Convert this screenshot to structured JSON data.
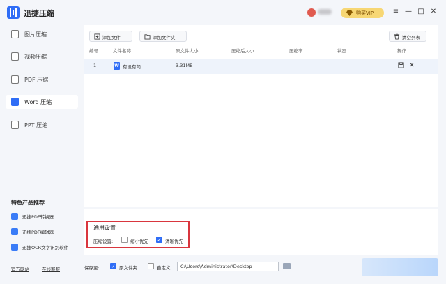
{
  "app": {
    "title": "迅捷压缩"
  },
  "header": {
    "vip_label": "购买VIP",
    "window_controls": [
      "≡",
      "—",
      "□",
      "✕"
    ],
    "accent": "#2f6df6",
    "vip_color": "#f7d774"
  },
  "sidebar": {
    "items": [
      {
        "label": "图片压缩",
        "icon": "image-icon",
        "active": false
      },
      {
        "label": "视频压缩",
        "icon": "video-icon",
        "active": false
      },
      {
        "label": "PDF 压缩",
        "icon": "pdf-icon",
        "active": false
      },
      {
        "label": "Word 压缩",
        "icon": "word-icon",
        "active": true
      },
      {
        "label": "PPT 压缩",
        "icon": "ppt-icon",
        "active": false
      }
    ],
    "featured_title": "特色产品推荐",
    "featured": [
      {
        "label": "迅捷PDF转换器",
        "icon": "pdf-converter-icon"
      },
      {
        "label": "迅捷PDF编辑器",
        "icon": "pdf-editor-icon"
      },
      {
        "label": "迅捷OCR文字识别软件",
        "icon": "ocr-icon"
      }
    ],
    "footer_links": [
      "官方网站",
      "在线客服"
    ]
  },
  "toolbar": {
    "add_file": "添加文件",
    "add_folder": "添加文件夹",
    "clear_list": "清空列表"
  },
  "table": {
    "columns": [
      "编号",
      "文件名称",
      "原文件大小",
      "压缩后大小",
      "压缩率",
      "状态",
      "操作"
    ],
    "rows": [
      {
        "index": "1",
        "name": "有没有简...",
        "orig_size": "3.31MB",
        "compressed_size": "-",
        "ratio": "-",
        "status": "",
        "file_icon": "W"
      }
    ]
  },
  "settings": {
    "title": "通用设置",
    "mode_label": "压缩设置:",
    "options": [
      {
        "label": "缩小优先",
        "checked": false
      },
      {
        "label": "清晰优先",
        "checked": true
      }
    ],
    "highlight_color": "#d9363e"
  },
  "bottom": {
    "save_to_label": "保存至:",
    "original_folder_label": "原文件夹",
    "original_folder_checked": true,
    "custom_label": "自定义",
    "custom_checked": false,
    "path": "C:\\Users\\Administrator\\Desktop"
  }
}
